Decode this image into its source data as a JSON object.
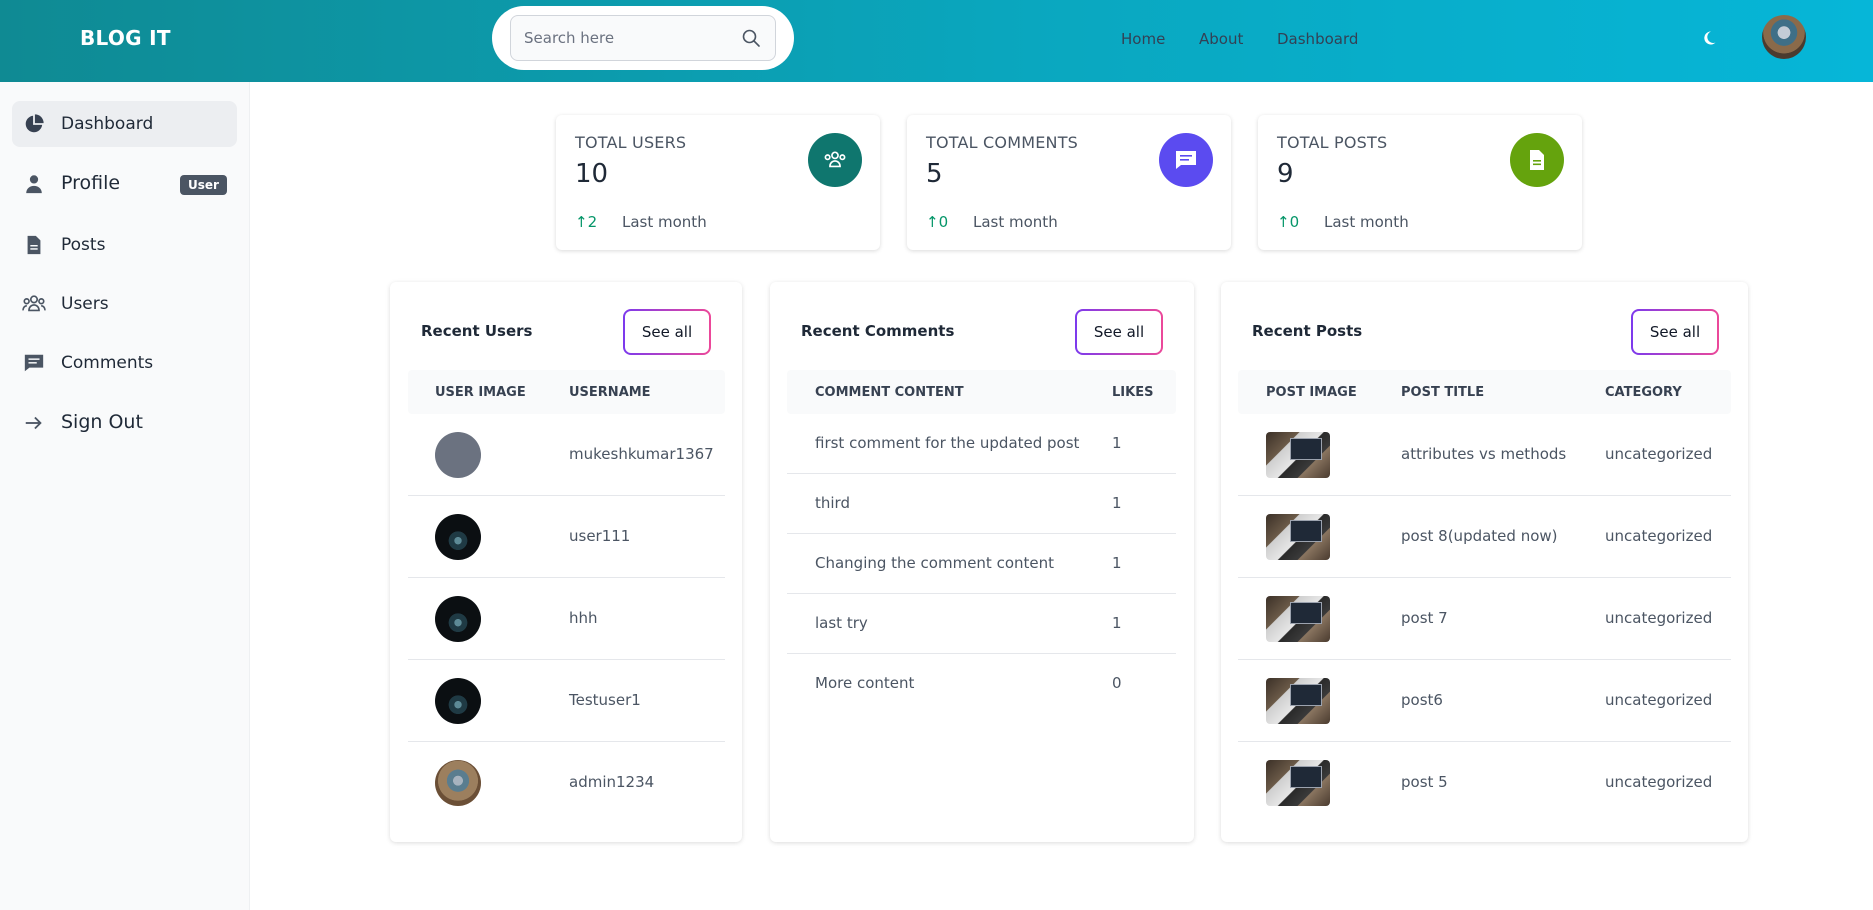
{
  "header": {
    "logo": "BLOG IT",
    "search_placeholder": "Search here",
    "nav": [
      "Home",
      "About",
      "Dashboard"
    ]
  },
  "sidebar": {
    "items": [
      {
        "label": "Dashboard",
        "icon": "pie-chart-icon"
      },
      {
        "label": "Profile",
        "icon": "user-icon",
        "badge": "User"
      },
      {
        "label": "Posts",
        "icon": "document-icon"
      },
      {
        "label": "Users",
        "icon": "users-group-icon"
      },
      {
        "label": "Comments",
        "icon": "comment-icon"
      },
      {
        "label": "Sign Out",
        "icon": "arrow-right-icon"
      }
    ]
  },
  "stats": [
    {
      "title": "Total Users",
      "value": "10",
      "trend": "2",
      "period": "Last month",
      "color": "#0f766e",
      "icon": "users-group-icon"
    },
    {
      "title": "Total Comments",
      "value": "5",
      "trend": "0",
      "period": "Last month",
      "color": "#5b4bf0",
      "icon": "comment-icon"
    },
    {
      "title": "Total Posts",
      "value": "9",
      "trend": "0",
      "period": "Last month",
      "color": "#65a30d",
      "icon": "document-icon"
    }
  ],
  "recent_users": {
    "title": "Recent Users",
    "see_all": "See all",
    "columns": [
      "User image",
      "Username"
    ],
    "rows": [
      {
        "username": "mukeshkumar1367",
        "avatar": "default-avatar"
      },
      {
        "username": "user111",
        "avatar": "hooded-figure"
      },
      {
        "username": "hhh",
        "avatar": "hooded-figure"
      },
      {
        "username": "Testuser1",
        "avatar": "hooded-figure"
      },
      {
        "username": "admin1234",
        "avatar": "person-photo"
      }
    ]
  },
  "recent_comments": {
    "title": "Recent Comments",
    "see_all": "See all",
    "columns": [
      "Comment content",
      "Likes"
    ],
    "rows": [
      {
        "content": "first comment for the updated post",
        "likes": "1"
      },
      {
        "content": "third",
        "likes": "1"
      },
      {
        "content": "Changing the comment content",
        "likes": "1"
      },
      {
        "content": "last try",
        "likes": "1"
      },
      {
        "content": "More content",
        "likes": "0"
      }
    ]
  },
  "recent_posts": {
    "title": "Recent Posts",
    "see_all": "See all",
    "columns": [
      "Post image",
      "Post title",
      "Category"
    ],
    "rows": [
      {
        "title": "attributes vs methods",
        "category": "uncategorized"
      },
      {
        "title": "post 8(updated now)",
        "category": "uncategorized"
      },
      {
        "title": "post 7",
        "category": "uncategorized"
      },
      {
        "title": "post6",
        "category": "uncategorized"
      },
      {
        "title": "post 5",
        "category": "uncategorized"
      }
    ]
  }
}
